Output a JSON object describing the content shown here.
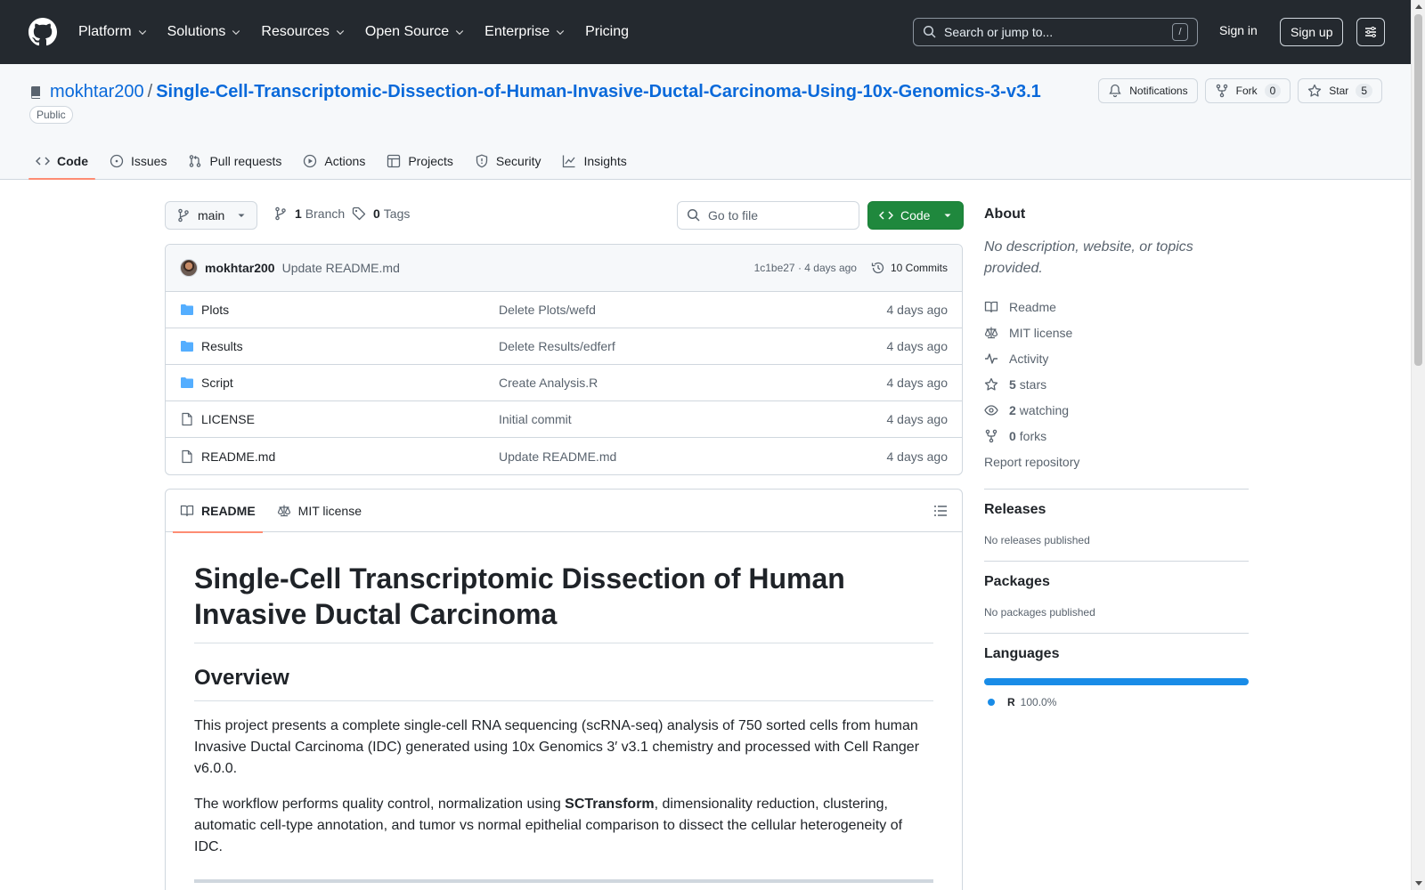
{
  "header": {
    "nav": [
      {
        "label": "Platform",
        "dropdown": true
      },
      {
        "label": "Solutions",
        "dropdown": true
      },
      {
        "label": "Resources",
        "dropdown": true
      },
      {
        "label": "Open Source",
        "dropdown": true
      },
      {
        "label": "Enterprise",
        "dropdown": true
      },
      {
        "label": "Pricing",
        "dropdown": false
      }
    ],
    "search_placeholder": "Search or jump to...",
    "search_shortcut": "/",
    "sign_in": "Sign in",
    "sign_up": "Sign up"
  },
  "repo": {
    "owner": "mokhtar200",
    "separator": "/",
    "name": "Single-Cell-Transcriptomic-Dissection-of-Human-Invasive-Ductal-Carcinoma-Using-10x-Genomics-3-v3.1",
    "visibility": "Public",
    "actions": {
      "notifications": "Notifications",
      "fork": "Fork",
      "fork_count": "0",
      "star": "Star",
      "star_count": "5"
    },
    "tabs": [
      {
        "label": "Code",
        "icon": "code-icon",
        "active": true
      },
      {
        "label": "Issues",
        "icon": "issue-icon"
      },
      {
        "label": "Pull requests",
        "icon": "pull-request-icon"
      },
      {
        "label": "Actions",
        "icon": "play-icon"
      },
      {
        "label": "Projects",
        "icon": "table-icon"
      },
      {
        "label": "Security",
        "icon": "shield-icon"
      },
      {
        "label": "Insights",
        "icon": "graph-icon"
      }
    ]
  },
  "toolbar": {
    "branch": "main",
    "branch_count": "1",
    "branch_label": "Branch",
    "tag_count": "0",
    "tag_label": "Tags",
    "goto_placeholder": "Go to file",
    "code_button": "Code"
  },
  "latest_commit": {
    "author": "mokhtar200",
    "message": "Update README.md",
    "hash_age": "1c1be27 · 4 days ago",
    "commits": "10 Commits"
  },
  "files": [
    {
      "name": "Plots",
      "type": "folder",
      "message": "Delete Plots/wefd",
      "age": "4 days ago"
    },
    {
      "name": "Results",
      "type": "folder",
      "message": "Delete Results/edferf",
      "age": "4 days ago"
    },
    {
      "name": "Script",
      "type": "folder",
      "message": "Create Analysis.R",
      "age": "4 days ago"
    },
    {
      "name": "LICENSE",
      "type": "file",
      "message": "Initial commit",
      "age": "4 days ago"
    },
    {
      "name": "README.md",
      "type": "file",
      "message": "Update README.md",
      "age": "4 days ago"
    }
  ],
  "readme": {
    "tabs": [
      "README",
      "MIT license"
    ],
    "title": "Single-Cell Transcriptomic Dissection of Human Invasive Ductal Carcinoma",
    "overview_heading": "Overview",
    "p1": "This project presents a complete single-cell RNA sequencing (scRNA-seq) analysis of 750 sorted cells from human Invasive Ductal Carcinoma (IDC) generated using 10x Genomics 3′ v3.1 chemistry and processed with Cell Ranger v6.0.0.",
    "p2_before": "The workflow performs quality control, normalization using ",
    "p2_bold": "SCTransform",
    "p2_after": ", dimensionality reduction, clustering, automatic cell-type annotation, and tumor vs normal epithelial comparison to dissect the cellular heterogeneity of IDC."
  },
  "sidebar": {
    "about_heading": "About",
    "description": "No description, website, or topics provided.",
    "items": [
      {
        "icon": "book-icon",
        "count": "",
        "label": "Readme"
      },
      {
        "icon": "law-icon",
        "count": "",
        "label": "MIT license"
      },
      {
        "icon": "pulse-icon",
        "count": "",
        "label": "Activity"
      },
      {
        "icon": "star-icon",
        "count": "5",
        "label": "stars"
      },
      {
        "icon": "eye-icon",
        "count": "2",
        "label": "watching"
      },
      {
        "icon": "fork-icon",
        "count": "0",
        "label": "forks"
      }
    ],
    "report": "Report repository",
    "releases_heading": "Releases",
    "releases_empty": "No releases published",
    "packages_heading": "Packages",
    "packages_empty": "No packages published",
    "languages_heading": "Languages",
    "languages": [
      {
        "name": "R",
        "percent": "100.0%",
        "color": "#198ce7"
      }
    ]
  },
  "colors": {
    "header_bg": "#24292f",
    "link": "#0969da",
    "primary_button": "#1f883d",
    "active_tab_underline": "#fd8c73"
  }
}
